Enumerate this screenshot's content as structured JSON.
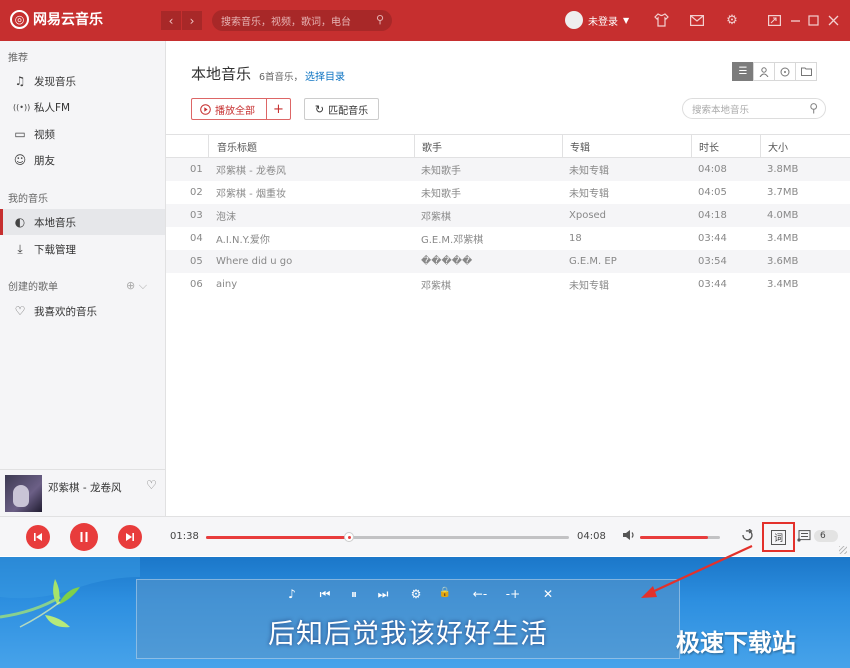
{
  "app": {
    "logo_glyph": "◎",
    "name": "网易云音乐"
  },
  "titlebar": {
    "back": "‹",
    "forward": "›",
    "search_placeholder": "搜索音乐，视频，歌词，电台",
    "user_label": "未登录",
    "accent": "#c62f2f",
    "icons": [
      "shirt-icon",
      "mail-icon",
      "gear-icon",
      "mini-mode-icon",
      "minimize-icon",
      "maximize-icon",
      "close-icon"
    ]
  },
  "sidebar": {
    "sections": {
      "recommend": "推荐",
      "my_music": "我的音乐",
      "created": "创建的歌单"
    },
    "items": [
      {
        "label": "发现音乐",
        "icon": "♫"
      },
      {
        "label": "私人FM",
        "icon": "((•))"
      },
      {
        "label": "视频",
        "icon": "▭"
      },
      {
        "label": "朋友",
        "icon": "☺"
      },
      {
        "label": "本地音乐",
        "icon": "◐"
      },
      {
        "label": "下载管理",
        "icon": "⤓"
      },
      {
        "label": "我喜欢的音乐",
        "icon": "♡"
      }
    ]
  },
  "now_playing": {
    "title": "邓紫棋 - 龙卷风"
  },
  "main": {
    "title": "本地音乐",
    "song_count": "6首音乐，",
    "choose_dir": "选择目录",
    "play_all": "播放全部",
    "add": "+",
    "match": "匹配音乐",
    "search_placeholder": "搜索本地音乐",
    "columns": [
      "音乐标题",
      "歌手",
      "专辑",
      "时长",
      "大小"
    ],
    "rows": [
      {
        "no": "01",
        "title": "邓紫棋 - 龙卷风",
        "artist": "未知歌手",
        "album": "未知专辑",
        "duration": "04:08",
        "size": "3.8MB"
      },
      {
        "no": "02",
        "title": "邓紫棋 - 烟重妆",
        "artist": "未知歌手",
        "album": "未知专辑",
        "duration": "04:05",
        "size": "3.7MB"
      },
      {
        "no": "03",
        "title": "泡沫",
        "artist": "邓紫棋",
        "album": "Xposed",
        "duration": "04:18",
        "size": "4.0MB"
      },
      {
        "no": "04",
        "title": "A.I.N.Y.爱你",
        "artist": "G.E.M.邓紫棋",
        "album": "18",
        "duration": "03:44",
        "size": "3.4MB"
      },
      {
        "no": "05",
        "title": "Where did u go",
        "artist": "�����",
        "album": "G.E.M. EP",
        "duration": "03:54",
        "size": "3.6MB"
      },
      {
        "no": "06",
        "title": "ainy",
        "artist": "邓紫棋",
        "album": "未知专辑",
        "duration": "03:44",
        "size": "3.4MB"
      }
    ]
  },
  "player": {
    "current_time": "01:38",
    "total_time": "04:08",
    "progress": 0.395,
    "volume": 0.85,
    "lyric_button": "词",
    "queue_count": "6"
  },
  "desktop_lyric": {
    "text": "后知后觉我该好好生活",
    "tools": [
      "♪",
      "⏮",
      "⏸",
      "⏭",
      "⚙",
      "🔒",
      "←-",
      "-+",
      "✕"
    ]
  },
  "watermark": "极速下载站"
}
